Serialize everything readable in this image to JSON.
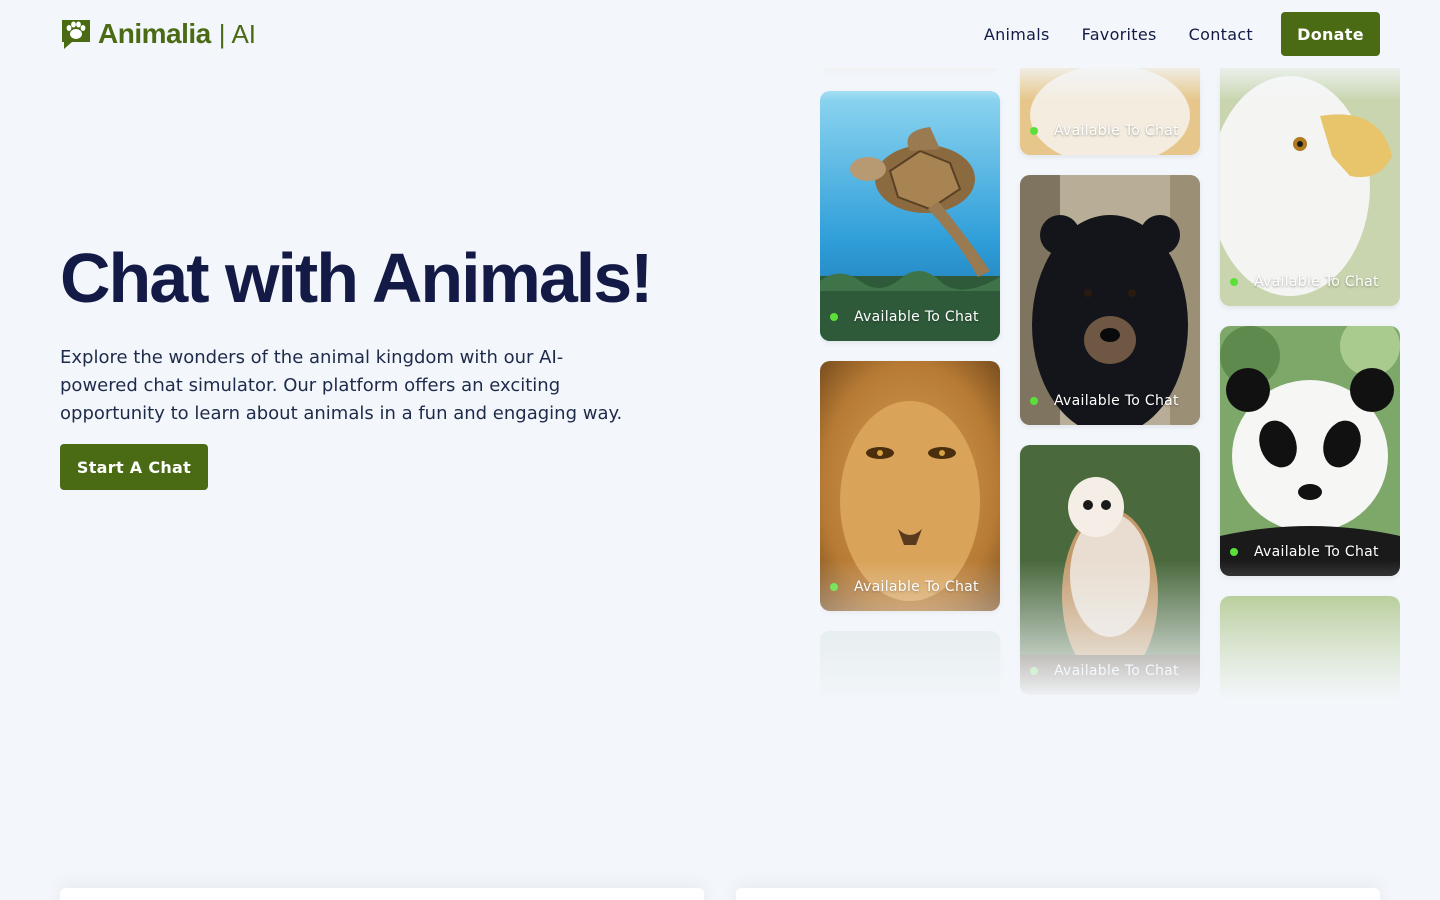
{
  "brand": {
    "name": "Animalia",
    "separator": "|",
    "suffix": "AI"
  },
  "nav": {
    "items": [
      {
        "label": "Animals"
      },
      {
        "label": "Favorites"
      },
      {
        "label": "Contact"
      }
    ],
    "donate_label": "Donate"
  },
  "hero": {
    "title": "Chat with Animals!",
    "description": "Explore the wonders of the animal kingdom with our AI-powered chat simulator. Our platform offers an exciting opportunity to learn about animals in a fun and engaging way.",
    "cta_label": "Start A Chat"
  },
  "cards": [
    {
      "animal": "sea turtle",
      "status": "Available To Chat"
    },
    {
      "animal": "lion",
      "status": "Available To Chat"
    },
    {
      "animal": "tiger",
      "status": "Available To Chat"
    },
    {
      "animal": "black bear",
      "status": "Available To Chat"
    },
    {
      "animal": "barn owl",
      "status": "Available To Chat"
    },
    {
      "animal": "bald eagle",
      "status": "Available To Chat"
    },
    {
      "animal": "panda",
      "status": "Available To Chat"
    }
  ],
  "colors": {
    "brand_green": "#4a6b14",
    "heading_navy": "#131a45",
    "status_dot": "#5be03a",
    "page_background": "#f3f7fb"
  }
}
